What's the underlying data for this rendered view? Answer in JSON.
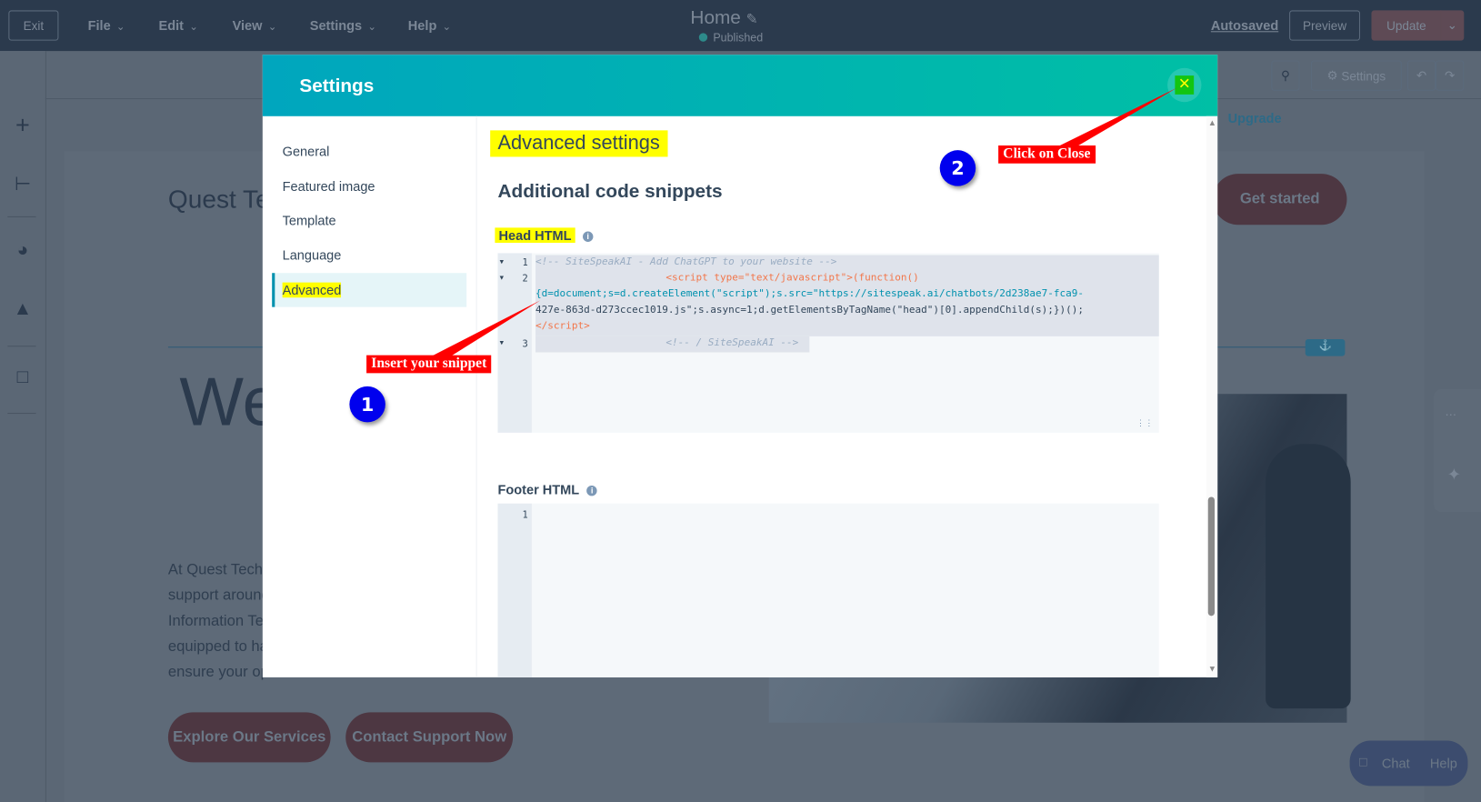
{
  "topbar": {
    "exit": "Exit",
    "menus": [
      "File",
      "Edit",
      "View",
      "Settings",
      "Help"
    ],
    "page_title": "Home",
    "status": "Published",
    "autosaved": "Autosaved",
    "preview": "Preview",
    "update": "Update"
  },
  "subbar": {
    "settings": "Settings",
    "upgrade": "Upgrade"
  },
  "background": {
    "brand": "Quest Tec",
    "hero": "We",
    "get_started": "Get started",
    "body_lines": [
      "At Quest Tech",
      "support around",
      "Information Te",
      "equipped to ha",
      "ensure your op"
    ],
    "explore": "Explore Our Services",
    "contact": "Contact Support Now",
    "chat": "Chat",
    "help": "Help"
  },
  "modal": {
    "title": "Settings",
    "nav": [
      "General",
      "Featured image",
      "Template",
      "Language",
      "Advanced"
    ],
    "heading": "Advanced settings",
    "subheading": "Additional code snippets",
    "head_label": "Head HTML",
    "footer_label": "Footer HTML",
    "head_code": {
      "line1": "<!-- SiteSpeakAI - Add ChatGPT to your website -->",
      "line2a": "<script type=\"text/javascript\">(function()",
      "line2b": "{d=document;s=d.createElement(\"script\");s.src=\"https://sitespeak.ai/chatbots/2d238ae7-fca9-",
      "line2c": "427e-863d-d273ccec1019.js\";s.async=1;d.getElementsByTagName(\"head\")[0].appendChild(s);})();",
      "line2d": "</script>",
      "line3": "<!-- / SiteSpeakAI -->"
    },
    "line_numbers": [
      "1",
      "2",
      "3"
    ],
    "footer_line_numbers": [
      "1"
    ]
  },
  "annotations": {
    "insert": "Insert your snippet",
    "close": "Click on Close",
    "step1": "1",
    "step2": "2"
  },
  "colors": {
    "header_start": "#00a6be",
    "header_end": "#00bfa5",
    "highlight": "#ffff00",
    "callout": "#ff0000",
    "badge": "#0000ee"
  }
}
